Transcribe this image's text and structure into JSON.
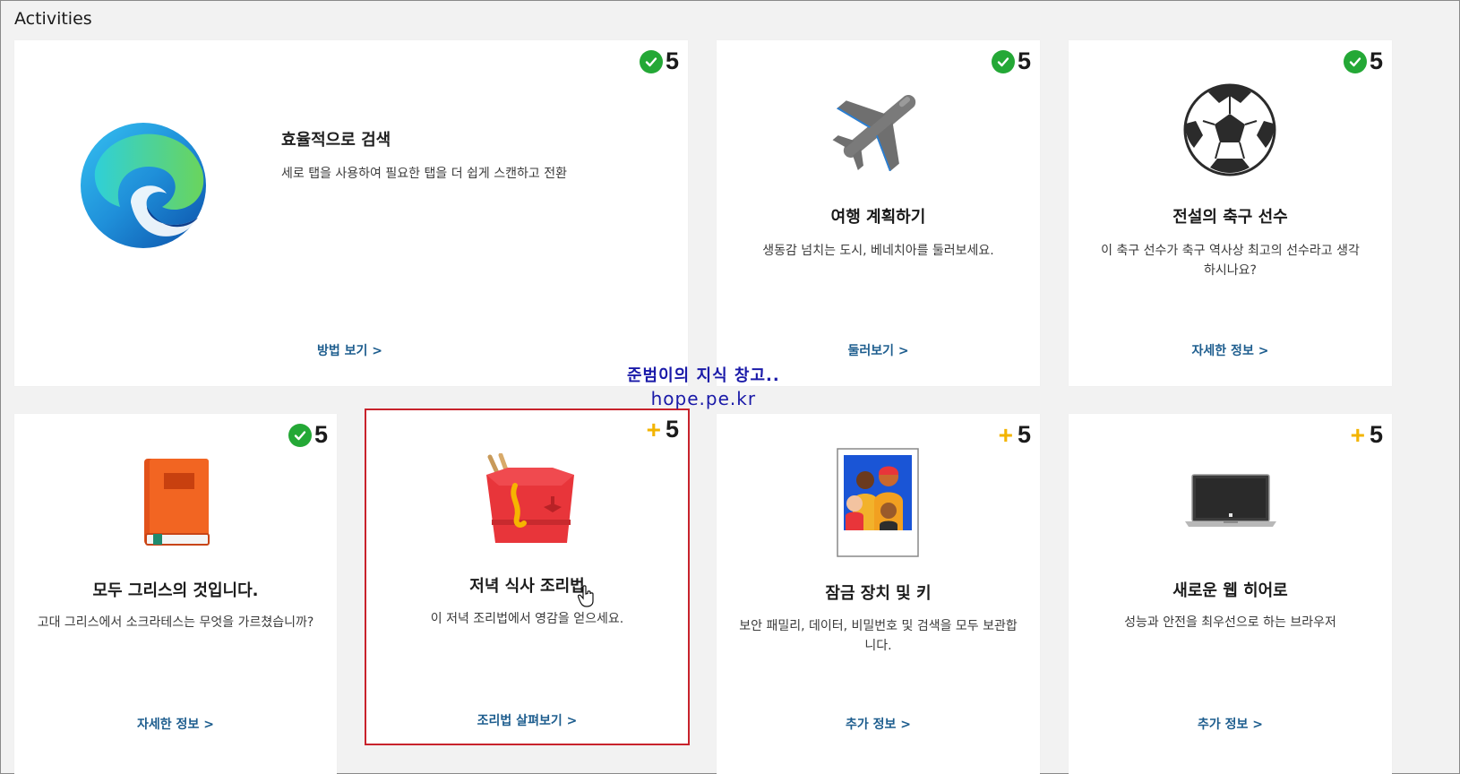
{
  "section_title": "Activities",
  "cards": [
    {
      "points": "5",
      "status": "completed",
      "title": "효율적으로 검색",
      "desc": "세로 탭을 사용하여 필요한 탭을 더 쉽게 스캔하고 전환",
      "link": "방법 보기 >",
      "icon": "edge-logo-icon"
    },
    {
      "points": "5",
      "status": "completed",
      "title": "여행 계획하기",
      "desc": "생동감 넘치는 도시, 베네치아를 둘러보세요.",
      "link": "둘러보기 >",
      "icon": "airplane-icon"
    },
    {
      "points": "5",
      "status": "completed",
      "title": "전설의 축구 선수",
      "desc": "이 축구 선수가 축구 역사상 최고의 선수라고 생각하시나요?",
      "link": "자세한 정보 >",
      "icon": "soccer-ball-icon"
    },
    {
      "points": "5",
      "status": "completed",
      "title": "모두 그리스의 것입니다.",
      "desc": "고대 그리스에서 소크라테스는 무엇을 가르쳤습니까?",
      "link": "자세한 정보 >",
      "icon": "book-icon"
    },
    {
      "points": "5",
      "status": "available",
      "title": "저녁 식사 조리법",
      "desc": "이 저녁 조리법에서 영감을 얻으세요.",
      "link": "조리법 살펴보기 >",
      "icon": "takeout-box-icon"
    },
    {
      "points": "5",
      "status": "available",
      "title": "잠금 장치 및 키",
      "desc": "보안 패밀리, 데이터, 비밀번호 및 검색을 모두 보관합니다.",
      "link": "추가 정보 >",
      "icon": "family-photo-icon"
    },
    {
      "points": "5",
      "status": "available",
      "title": "새로운 웹 히어로",
      "desc": "성능과 안전을 최우선으로 하는 브라우저",
      "link": "추가 정보 >",
      "icon": "laptop-icon"
    }
  ],
  "watermark": {
    "line1": "준범이의 지식 창고..",
    "line2": "hope.pe.kr"
  },
  "colors": {
    "check_green": "#24a836",
    "plus_yellow": "#f3b400",
    "link_blue": "#1d5d8e",
    "highlight_red": "#c8232c"
  }
}
